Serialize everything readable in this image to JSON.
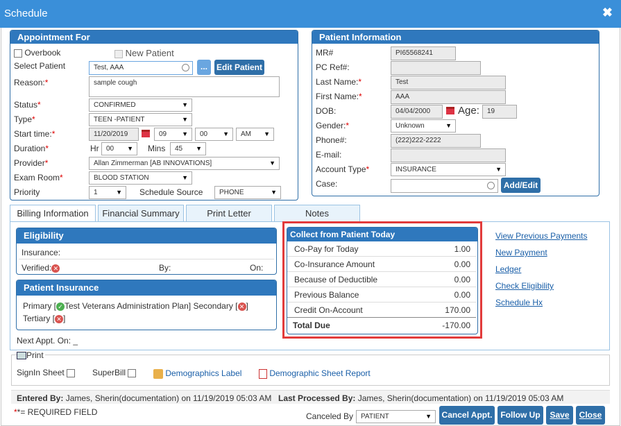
{
  "window": {
    "title": "Schedule"
  },
  "appointment": {
    "header": "Appointment For",
    "overbook": "Overbook",
    "new_patient": "New Patient",
    "select_patient_label": "Select Patient",
    "select_patient_value": "Test, AAA",
    "ellipsis": "...",
    "edit_patient": "Edit Patient",
    "reason_label": "Reason:",
    "reason_value": "sample cough",
    "status_label": "Status",
    "status_value": "CONFIRMED",
    "type_label": "Type",
    "type_value": "TEEN -PATIENT",
    "start_label": "Start time:",
    "start_date": "11/20/2019",
    "start_hour": "09",
    "start_min": "00",
    "start_ampm": "AM",
    "duration_label": "Duration",
    "hr_label": "Hr",
    "hr_value": "00",
    "mins_label": "Mins",
    "mins_value": "45",
    "provider_label": "Provider",
    "provider_value": "Allan Zimmerman [AB INNOVATIONS]",
    "exam_label": "Exam Room",
    "exam_value": "BLOOD STATION",
    "priority_label": "Priority",
    "priority_value": "1",
    "source_label": "Schedule Source",
    "source_value": "PHONE"
  },
  "patient": {
    "header": "Patient Information",
    "mr_label": "MR#",
    "mr_value": "PI65568241",
    "pcref_label": "PC Ref#:",
    "pcref_value": "",
    "last_label": "Last Name:",
    "last_value": "Test",
    "first_label": "First Name:",
    "first_value": "AAA",
    "dob_label": "DOB:",
    "dob_value": "04/04/2000",
    "age_label": "Age:",
    "age_value": "19",
    "gender_label": "Gender:",
    "gender_value": "Unknown",
    "phone_label": "Phone#:",
    "phone_value": "(222)222-2222",
    "email_label": "E-mail:",
    "email_value": "",
    "account_label": "Account Type",
    "account_value": "INSURANCE",
    "case_label": "Case:",
    "case_value": "",
    "add_edit": "Add/Edit"
  },
  "tabs": [
    "Billing Information",
    "Financial Summary",
    "Print Letter",
    "Notes"
  ],
  "eligibility": {
    "header": "Eligibility",
    "insurance_label": "Insurance:",
    "verified_label": "Verified:",
    "by_label": "By:",
    "on_label": "On:"
  },
  "patient_insurance": {
    "header": "Patient Insurance",
    "primary_label": "Primary [",
    "primary_plan": "Test Veterans Administration Plan]",
    "secondary_label": "Secondary [",
    "close_bracket": "]",
    "tertiary_label": "Tertiary ["
  },
  "collect": {
    "header": "Collect from Patient Today",
    "rows": [
      {
        "name": "Co-Pay for Today",
        "value": "1.00"
      },
      {
        "name": "Co-Insurance Amount",
        "value": "0.00"
      },
      {
        "name": "Because of Deductible",
        "value": "0.00"
      },
      {
        "name": "Previous Balance",
        "value": "0.00"
      },
      {
        "name": "Credit On-Account",
        "value": "170.00"
      }
    ],
    "total_label": "Total Due",
    "total_value": "-170.00"
  },
  "links": [
    "View Previous Payments",
    "New Payment",
    "Ledger",
    "Check Eligibility",
    "Schedule Hx"
  ],
  "next_appt": "Next Appt. On: _",
  "print": {
    "legend": "Print",
    "signin": "SignIn Sheet",
    "superbill": "SuperBill",
    "demographics_label": "Demographics Label",
    "demographic_sheet": "Demographic Sheet Report"
  },
  "audit": {
    "entered_label": "Entered By:",
    "entered_value": "James, Sherin(documentation) on 11/19/2019 05:03 AM",
    "processed_label": "Last Processed By:",
    "processed_value": "James, Sherin(documentation) on 11/19/2019 05:03 AM"
  },
  "footer": {
    "required_note": "*= REQUIRED FIELD",
    "canceled_by_label": "Canceled By",
    "canceled_by_value": "PATIENT",
    "cancel_appt": "Cancel Appt.",
    "follow_up": "Follow Up",
    "save": "Save",
    "close": "Close"
  },
  "colors": {
    "accent": "#2f6fa8",
    "titlebar": "#3a8fd9",
    "highlight": "#e23b3b",
    "link": "#1a5fa8"
  }
}
